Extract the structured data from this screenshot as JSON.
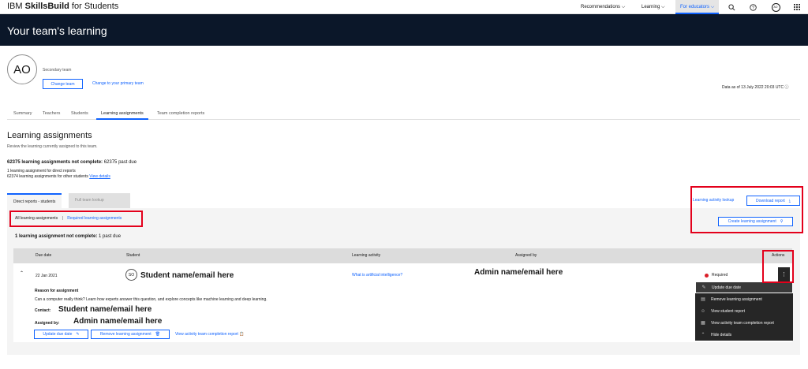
{
  "topnav": {
    "brand_plain": "IBM ",
    "brand_bold": "SkillsBuild",
    "brand_suffix": " for Students",
    "recommendations": "Recommendations",
    "learning": "Learning",
    "for_educators": "For educators",
    "avatar_initials": "AO"
  },
  "banner": {
    "title": "Your team's learning"
  },
  "profile": {
    "initials": "AO",
    "team_type": "Secondary team",
    "change_team": "Change team",
    "change_primary": "Change to your primary team",
    "data_as_of": "Data as of 13 July 2022 20:03 UTC"
  },
  "tabs": [
    {
      "label": "Summary"
    },
    {
      "label": "Teachers"
    },
    {
      "label": "Students"
    },
    {
      "label": "Learning assignments"
    },
    {
      "label": "Team completion reports"
    }
  ],
  "section": {
    "title": "Learning assignments",
    "subtitle": "Review the learning currently assigned to this team.",
    "stats_bold": "62375 learning assignments not complete:",
    "stats_rest": " 62375 past due",
    "direct_line": "1 learning assignment for direct reports",
    "other_line": "62374 learning assignments for other students",
    "view_details": "View details"
  },
  "subtabs": {
    "direct": "Direct reports - students",
    "full": "Full team lookup"
  },
  "actions": {
    "lookup": "Learning activity lookup",
    "download": "Download report",
    "create": "Create learning assignment"
  },
  "filters": {
    "all": "All learning assignments",
    "sep": "|",
    "required": "Required learning assignments"
  },
  "count": {
    "bold": "1 learning assignment not complete:",
    "rest": " 1 past due"
  },
  "table": {
    "headers": {
      "due": "Due date",
      "student": "Student",
      "activity": "Learning activity",
      "assigned": "Assigned by",
      "actions": "Actions"
    },
    "row": {
      "due": "22 Jan 2021",
      "student_initials": "SO",
      "student": "Student name/email here",
      "activity": "What is artificial intelligence?",
      "assigned": "Admin name/email here",
      "status": "Required",
      "reason_label": "Reason for assignment",
      "reason_text": "Can a computer really think? Learn how experts answer this question, and explore concepts like machine learning and deep learning.",
      "contact_label": "Contact:",
      "contact_value": "Student name/email here",
      "assigned_label": "Assigned by:",
      "assigned_value": "Admin name/email here",
      "btn_update": "Update due date",
      "btn_remove": "Remove learning assignment",
      "btn_view": "View activity team completion report"
    }
  },
  "menu": [
    {
      "label": "Update due date",
      "icon": "pencil-icon"
    },
    {
      "label": "Remove learning assignment",
      "icon": "trash-icon"
    },
    {
      "label": "View student report",
      "icon": "user-icon"
    },
    {
      "label": "View activity team completion report",
      "icon": "clipboard-icon"
    },
    {
      "label": "Hide details",
      "icon": "chevron-up-icon"
    }
  ],
  "colors": {
    "accent": "#0f62fe",
    "banner": "#0b1729",
    "highlight": "#e3001b",
    "required_dot": "#da1e28"
  }
}
